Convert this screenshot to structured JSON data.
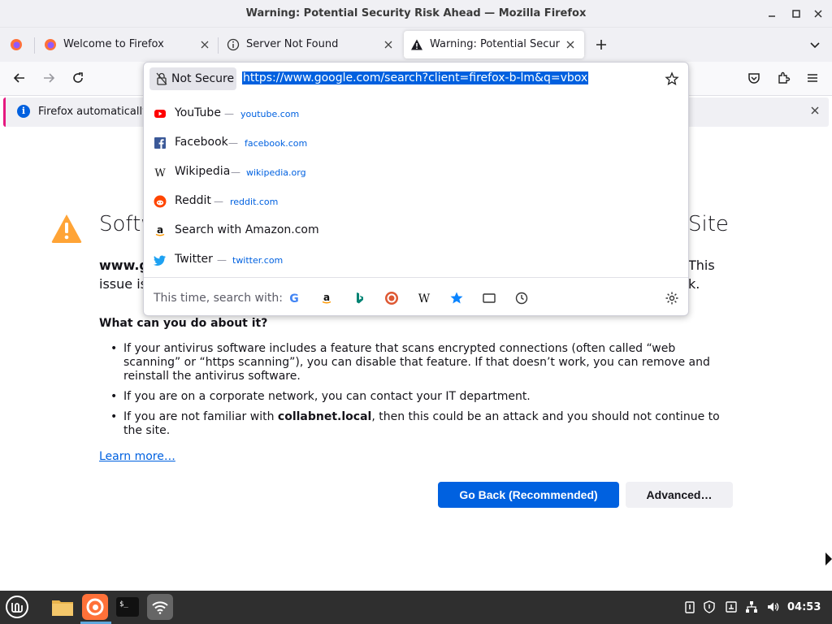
{
  "window": {
    "title": "Warning: Potential Security Risk Ahead — Mozilla Firefox"
  },
  "tabs": [
    {
      "label": "Welcome to Firefox",
      "icon": "firefox-icon"
    },
    {
      "label": "Server Not Found",
      "icon": "info-icon"
    },
    {
      "label": "Warning: Potential Security",
      "icon": "warning-icon",
      "active": true
    }
  ],
  "urlbar": {
    "security_label": "Not Secure",
    "url": "https://www.google.com/search?client=firefox-b-lm&q=vbox"
  },
  "suggestions": [
    {
      "title": "YouTube",
      "url": "youtube.com",
      "icon": "youtube-icon"
    },
    {
      "title": "Facebook",
      "url": "facebook.com",
      "icon": "facebook-icon"
    },
    {
      "title": "Wikipedia",
      "url": "wikipedia.org",
      "icon": "wikipedia-icon"
    },
    {
      "title": "Reddit",
      "url": "reddit.com",
      "icon": "reddit-icon"
    },
    {
      "title": "Search with Amazon.com",
      "url": "",
      "icon": "amazon-icon"
    },
    {
      "title": "Twitter",
      "url": "twitter.com",
      "icon": "twitter-icon"
    }
  ],
  "oneoff": {
    "label": "This time, search with:",
    "engines": [
      "google-icon",
      "amazon-icon",
      "bing-icon",
      "duckduckgo-icon",
      "wikipedia-icon",
      "bookmarks-icon",
      "tabs-icon",
      "history-icon"
    ]
  },
  "notice": {
    "message": "Firefox automatically"
  },
  "page": {
    "title_start": "Softw",
    "title_end": "Site",
    "intro_line1_start": "www.g",
    "intro_line1_end": "This",
    "intro_line2_start": "issue is",
    "intro_line2_end": "k.",
    "subheading": "What can you do about it?",
    "bullet1": "If your antivirus software includes a feature that scans encrypted connections (often called “web scanning” or “https scanning”), you can disable that feature. If that doesn’t work, you can remove and reinstall the antivirus software.",
    "bullet2": "If you are on a corporate network, you can contact your IT department.",
    "bullet3_pre": "If you are not familiar with ",
    "bullet3_bold": "collabnet.local",
    "bullet3_post": ", then this could be an attack and you should not continue to the site.",
    "learn_more": "Learn more…",
    "go_back": "Go Back (Recommended)",
    "advanced": "Advanced…"
  },
  "taskbar": {
    "clock": "04:53"
  },
  "colors": {
    "accent": "#0061e0",
    "warning": "#ffa436",
    "notice_border": "#e51980"
  }
}
